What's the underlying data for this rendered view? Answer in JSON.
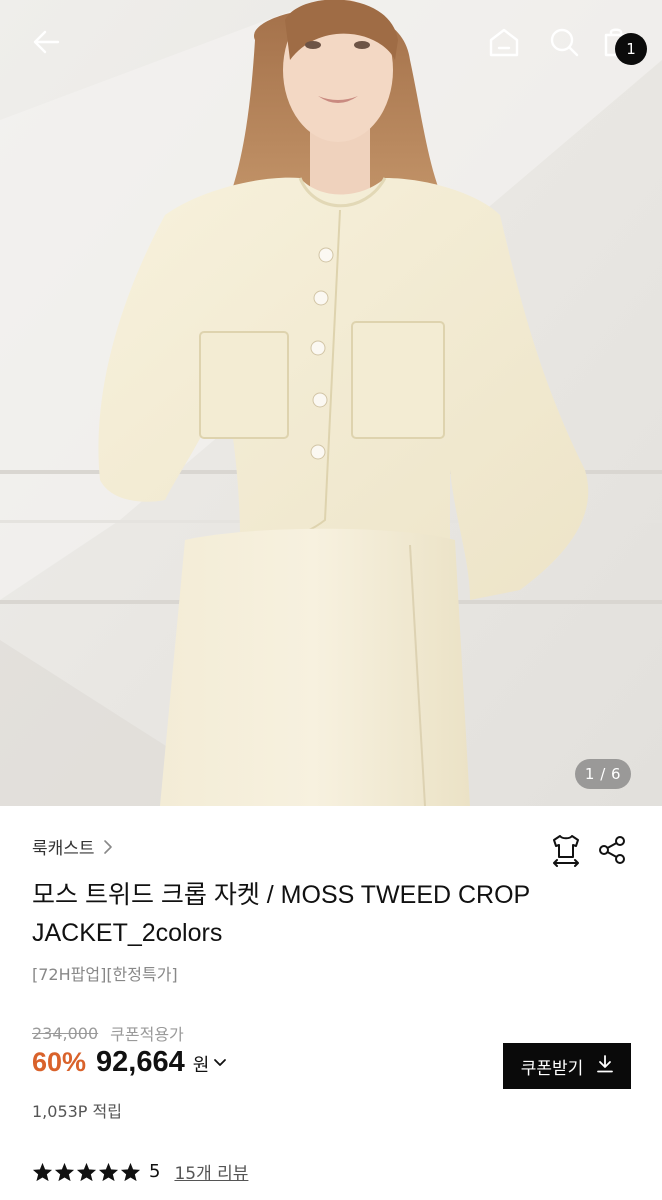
{
  "hero": {
    "image_alt": "",
    "page_indicator": "1 / 6"
  },
  "topbar": {
    "back_icon": "back-arrow-icon",
    "home_icon": "home-icon",
    "search_icon": "search-icon",
    "cart_icon": "shopping-bag-icon",
    "cart_count": "1"
  },
  "product": {
    "brand": "룩캐스트",
    "title": "모스 트위드 크롭 자켓 / MOSS TWEED CROP JACKET_2colors",
    "promo_tags": "[72H팝업][한정특가]",
    "original_price": "234,000",
    "coupon_applied_label": "쿠폰적용가",
    "discount_rate": "60%",
    "sale_price": "92,664",
    "currency": "원",
    "points": "1,053P 적립",
    "rating": "5",
    "rating_stars": 5,
    "review_link": "15개 리뷰"
  },
  "actions": {
    "fit_icon": "size-guide-shirt-icon",
    "share_icon": "share-icon",
    "coupon_button_label": "쿠폰받기"
  },
  "colors": {
    "accent": "#d9622b",
    "primary_button": "#0a0a0a",
    "muted_text": "#9a9a9a"
  }
}
